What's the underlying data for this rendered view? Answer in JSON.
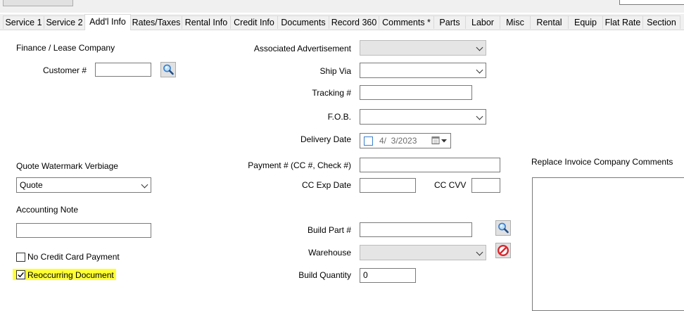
{
  "tabs": [
    "Service 1",
    "Service 2",
    "Add'l Info",
    "Rates/Taxes",
    "Rental Info",
    "Credit Info",
    "Documents",
    "Record 360",
    "Comments *",
    "Parts",
    "Labor",
    "Misc",
    "Rental",
    "Equip",
    "Flat Rate",
    "Section"
  ],
  "active_tab": "Add'l Info",
  "left": {
    "finance_heading": "Finance / Lease Company",
    "customer_label": "Customer #",
    "customer_value": "",
    "quote_watermark_label": "Quote Watermark Verbiage",
    "quote_watermark_value": "Quote",
    "accounting_note_label": "Accounting Note",
    "accounting_note_value": "",
    "no_credit_card_label": "No Credit Card Payment",
    "no_credit_card_checked": false,
    "reoccurring_label": "Reoccurring Document",
    "reoccurring_checked": true
  },
  "middle": {
    "associated_ad_label": "Associated Advertisement",
    "associated_ad_value": "",
    "ship_via_label": "Ship Via",
    "ship_via_value": "",
    "tracking_label": "Tracking #",
    "tracking_value": "",
    "fob_label": "F.O.B.",
    "fob_value": "",
    "delivery_date_label": "Delivery Date",
    "delivery_date_value": "4/  3/2023",
    "delivery_date_checked": false,
    "payment_label": "Payment # (CC #, Check #)",
    "payment_value": "",
    "cc_exp_label": "CC Exp Date",
    "cc_exp_value": "",
    "cc_cvv_label": "CC CVV",
    "cc_cvv_value": "",
    "build_part_label": "Build Part #",
    "build_part_value": "",
    "warehouse_label": "Warehouse",
    "warehouse_value": "",
    "build_qty_label": "Build Quantity",
    "build_qty_value": "0"
  },
  "right": {
    "replace_comments_label": "Replace Invoice Company Comments",
    "replace_comments_value": ""
  },
  "icons": {
    "search": "magnifier-icon",
    "cancel": "no-entry-icon",
    "calendar": "calendar-icon"
  },
  "colors": {
    "highlight": "#ffff33",
    "cancel_red": "#d9262c",
    "search_blue": "#3a7fcf"
  }
}
